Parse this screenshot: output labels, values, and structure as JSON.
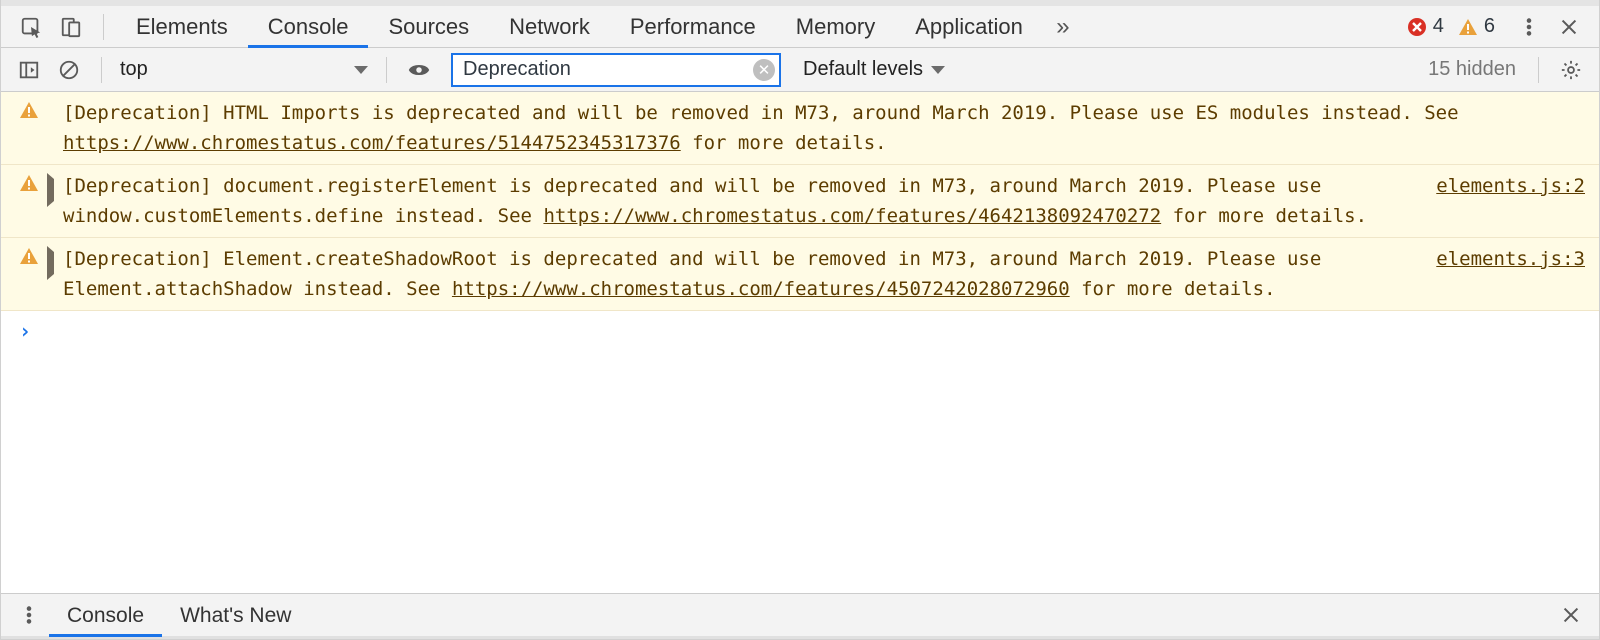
{
  "tabs": {
    "t0": "Elements",
    "t1": "Console",
    "t2": "Sources",
    "t3": "Network",
    "t4": "Performance",
    "t5": "Memory",
    "t6": "Application",
    "active": "Console"
  },
  "status": {
    "errors": "4",
    "warnings": "6"
  },
  "toolbar": {
    "context": "top",
    "filter_value": "Deprecation",
    "levels_label": "Default levels",
    "hidden_label": "15 hidden"
  },
  "messages": [
    {
      "expandable": false,
      "text_a": "[Deprecation] HTML Imports is deprecated and will be removed in M73, around March 2019. Please use ES modules instead. See ",
      "link": "https://www.chromestatus.com/features/5144752345317376",
      "text_b": " for more details.",
      "source": ""
    },
    {
      "expandable": true,
      "text_a": "[Deprecation] document.registerElement is deprecated and will be removed in M73, around March 2019. Please use window.customElements.define instead. See ",
      "link": "https://www.chromestatus.com/features/4642138092470272",
      "text_b": " for more details.",
      "source": "elements.js:2"
    },
    {
      "expandable": true,
      "text_a": "[Deprecation] Element.createShadowRoot is deprecated and will be removed in M73, around March 2019. Please use Element.attachShadow instead. See ",
      "link": "https://www.chromestatus.com/features/4507242028072960",
      "text_b": " for more details.",
      "source": "elements.js:3"
    }
  ],
  "drawer": {
    "d0": "Console",
    "d1": "What's New"
  },
  "prompt": "›"
}
